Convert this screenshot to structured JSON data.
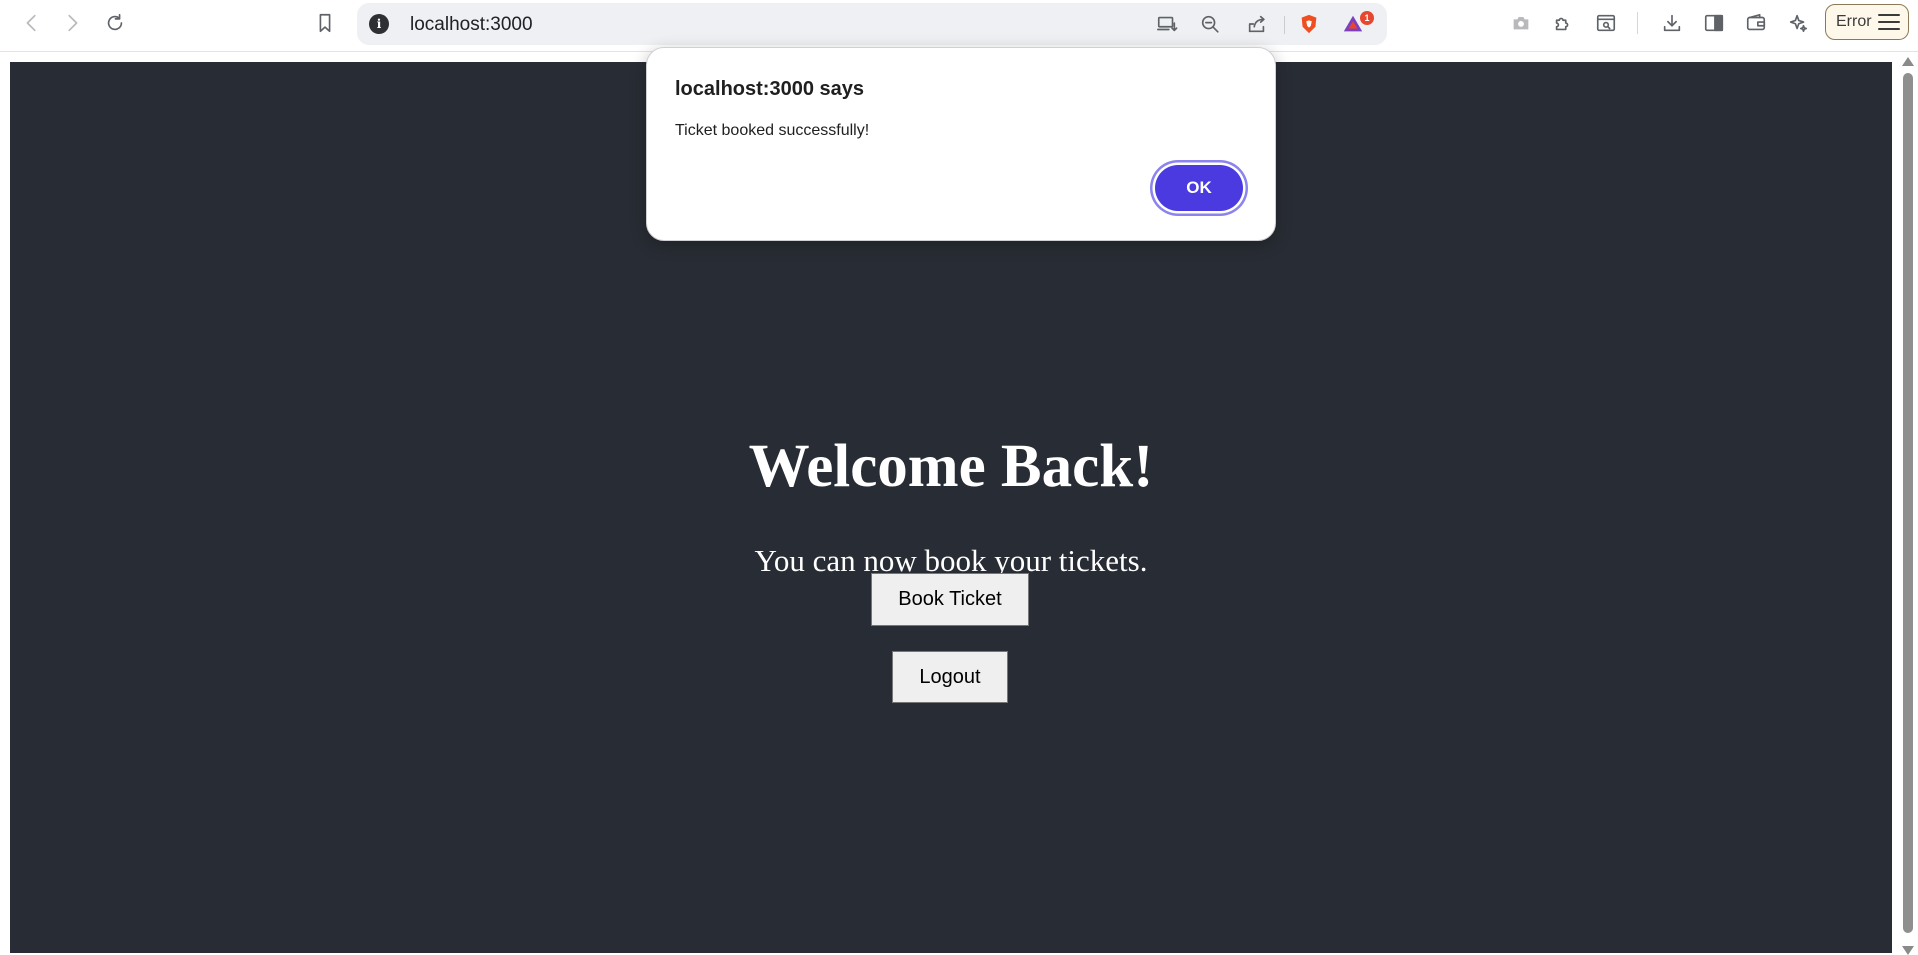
{
  "browser": {
    "url": "localhost:3000",
    "error_label": "Error",
    "notification_count": "1",
    "icons": [
      "back-icon",
      "forward-icon",
      "reload-icon",
      "bookmark-icon",
      "site-info-icon",
      "install-app-icon",
      "zoom-out-icon",
      "share-icon",
      "brave-shields-icon",
      "brave-rewards-icon",
      "screenshot-icon",
      "extensions-icon",
      "reader-mode-icon",
      "download-icon",
      "sidebar-icon",
      "wallet-icon",
      "leo-ai-icon",
      "menu-icon"
    ]
  },
  "page": {
    "heading": "Welcome Back!",
    "subtext": "You can now book your tickets.",
    "book_button": "Book Ticket",
    "logout_button": "Logout",
    "background_color": "#282c34"
  },
  "dialog": {
    "title": "localhost:3000 says",
    "message": "Ticket booked successfully!",
    "ok_label": "OK",
    "accent_color": "#4a3ae0"
  }
}
